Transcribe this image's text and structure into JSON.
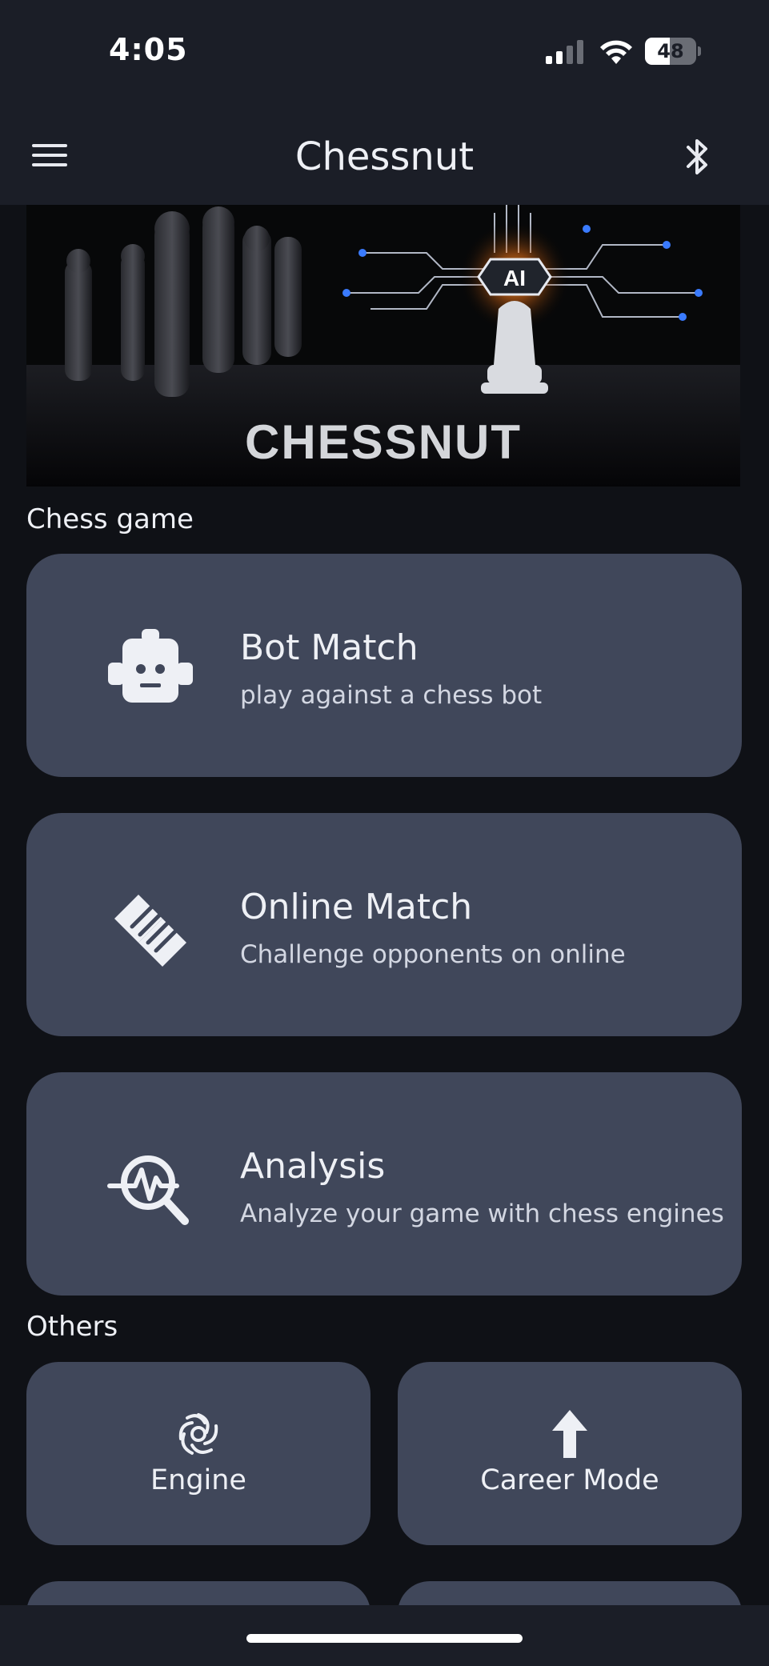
{
  "status_bar": {
    "time": "4:05",
    "battery_level": "48",
    "battery_fraction": 0.48,
    "signal_icon": "cellular-signal-icon",
    "wifi_icon": "wifi-icon"
  },
  "header": {
    "title": "Chessnut",
    "menu_icon": "hamburger-menu-icon",
    "bluetooth_icon": "bluetooth-icon"
  },
  "banner": {
    "text": "CHESSNUT",
    "chip_label": "AI"
  },
  "chess_game": {
    "section_title": "Chess game",
    "cards": [
      {
        "title": "Bot Match",
        "subtitle": "play against a chess bot",
        "icon": "robot-icon"
      },
      {
        "title": "Online Match",
        "subtitle": "Challenge opponents on online",
        "icon": "handshake-icon"
      },
      {
        "title": "Analysis",
        "subtitle": "Analyze your game with chess engines",
        "icon": "analysis-search-icon"
      }
    ]
  },
  "others": {
    "section_title": "Others",
    "tiles": [
      {
        "label": "Engine",
        "icon": "engine-swirl-icon"
      },
      {
        "label": "Career Mode",
        "icon": "arrow-up-icon"
      }
    ]
  },
  "colors": {
    "background": "#0f1116",
    "header": "#1b1e27",
    "card": "#40475a",
    "accent_blue": "#3a7bff",
    "accent_orange": "#ff9a3a"
  }
}
